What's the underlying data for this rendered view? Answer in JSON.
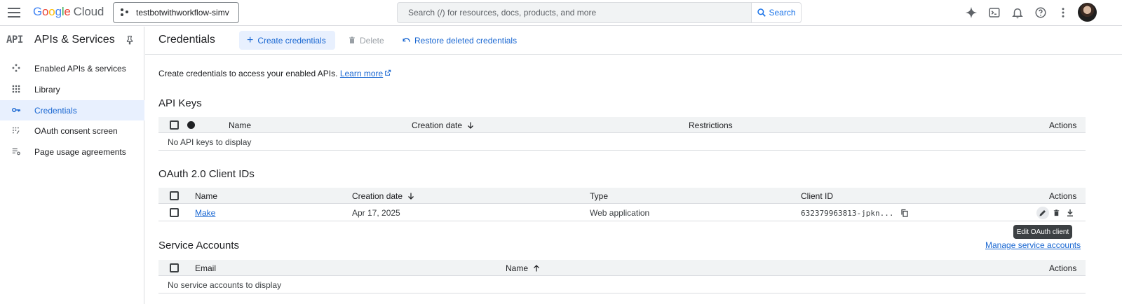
{
  "topbar": {
    "logo_google": [
      "G",
      "o",
      "o",
      "g",
      "l",
      "e"
    ],
    "logo_cloud": "Cloud",
    "project": "testbotwithworkflow-simv",
    "search_placeholder": "Search (/) for resources, docs, products, and more",
    "search_button": "Search",
    "icons": [
      "gemini-icon",
      "cloud-shell-icon",
      "notifications-icon",
      "help-icon",
      "more-vert-icon"
    ]
  },
  "sidebar": {
    "badge": "API",
    "title": "APIs & Services",
    "items": [
      {
        "label": "Enabled APIs & services",
        "icon": "apis-icon"
      },
      {
        "label": "Library",
        "icon": "library-icon"
      },
      {
        "label": "Credentials",
        "icon": "key-icon",
        "active": true
      },
      {
        "label": "OAuth consent screen",
        "icon": "consent-icon"
      },
      {
        "label": "Page usage agreements",
        "icon": "agreements-icon"
      }
    ]
  },
  "header": {
    "title": "Credentials",
    "create": "Create credentials",
    "delete": "Delete",
    "restore": "Restore deleted credentials"
  },
  "intro": {
    "text": "Create credentials to access your enabled APIs.",
    "learn_more": "Learn more"
  },
  "api_keys": {
    "title": "API Keys",
    "columns": {
      "name": "Name",
      "created": "Creation date",
      "restrictions": "Restrictions",
      "actions": "Actions"
    },
    "empty": "No API keys to display"
  },
  "oauth": {
    "title": "OAuth 2.0 Client IDs",
    "columns": {
      "name": "Name",
      "created": "Creation date",
      "type": "Type",
      "client_id": "Client ID",
      "actions": "Actions"
    },
    "rows": [
      {
        "name": "Make",
        "created": "Apr 17, 2025",
        "type": "Web application",
        "client_id": "632379963813-jpkn..."
      }
    ],
    "tooltip": "Edit OAuth client"
  },
  "service_accounts": {
    "title": "Service Accounts",
    "manage": "Manage service accounts",
    "columns": {
      "email": "Email",
      "name": "Name",
      "actions": "Actions"
    },
    "empty": "No service accounts to display"
  },
  "colors": {
    "accent": "#1967d2",
    "active_bg": "#e8f0fe",
    "header_bg": "#f1f3f4",
    "divider": "#dadce0"
  }
}
